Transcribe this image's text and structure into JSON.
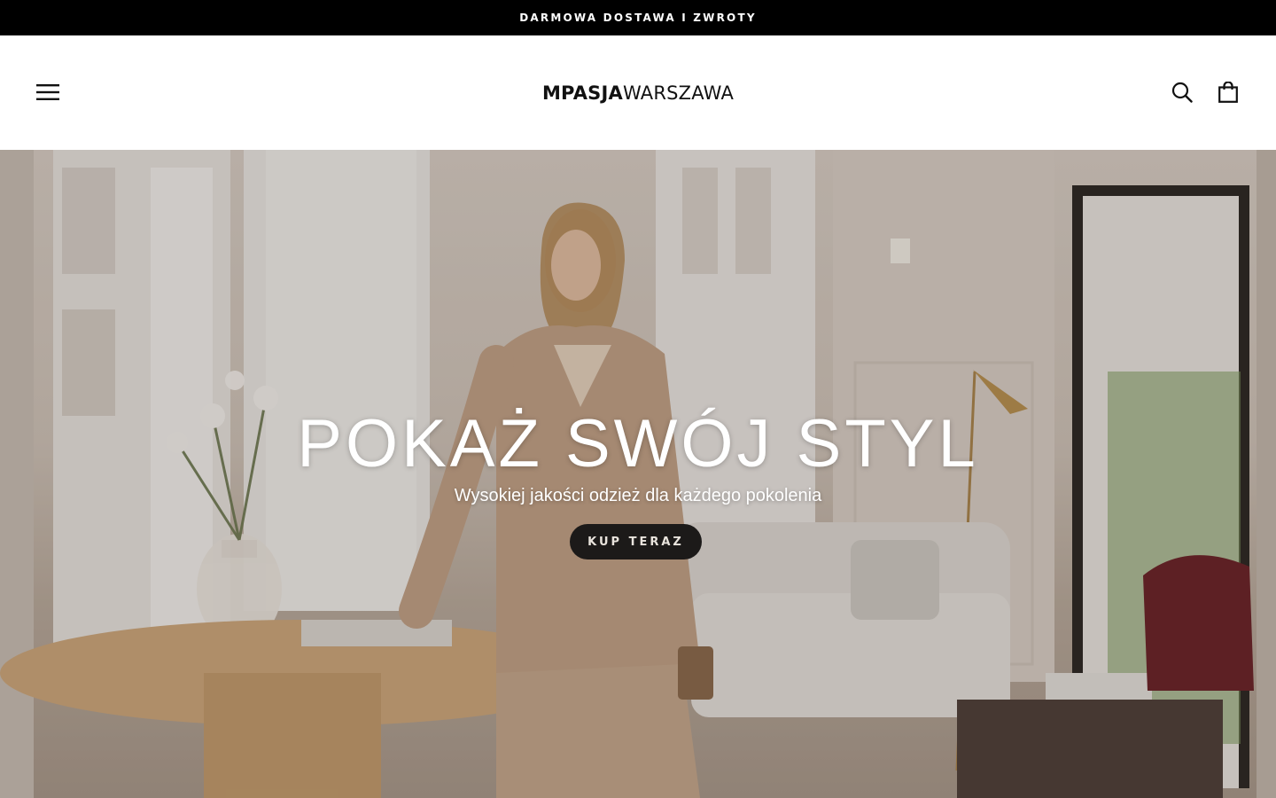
{
  "announcement": {
    "text": "DARMOWA DOSTAWA I ZWROTY"
  },
  "header": {
    "logo_bold": "MPASJA",
    "logo_light": "WARSZAWA",
    "icons": {
      "menu": "hamburger-menu-icon",
      "search": "search-icon",
      "cart": "shopping-bag-icon"
    }
  },
  "hero": {
    "title": "POKAŻ SWÓJ STYL",
    "subtitle": "Wysokiej jakości odzież dla każdego pokolenia",
    "cta_label": "KUP TERAZ",
    "image_alt_theme": "woman in beige suit in bright apartment interior"
  },
  "colors": {
    "announcement_bg": "#000000",
    "header_bg": "#ffffff",
    "cta_bg": "#1c1a19",
    "cta_text": "#e9e4dd",
    "hero_text": "#ffffff"
  }
}
